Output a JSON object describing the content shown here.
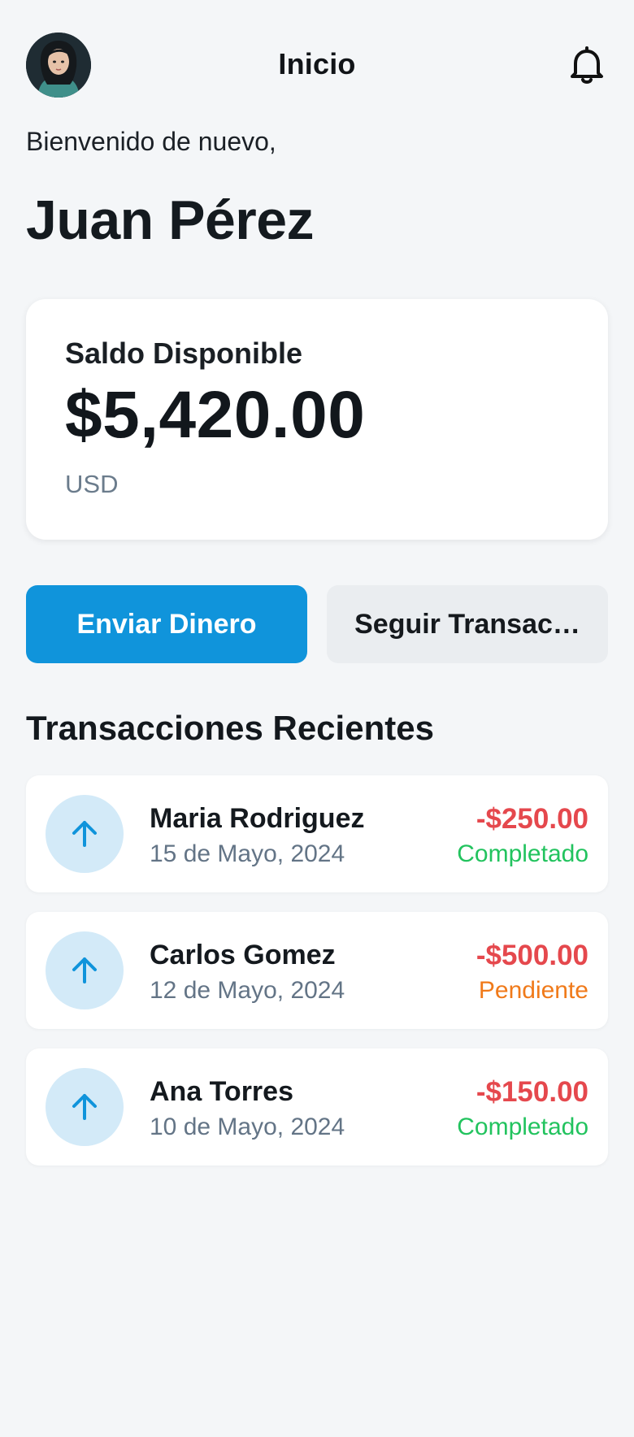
{
  "header": {
    "title": "Inicio",
    "avatar_icon": "user-avatar",
    "notification_icon": "bell-icon"
  },
  "greeting": {
    "welcome": "Bienvenido de nuevo,",
    "name": "Juan Pérez"
  },
  "balance": {
    "label": "Saldo Disponible",
    "amount": "$5,420.00",
    "currency": "USD"
  },
  "actions": {
    "send_label": "Enviar Dinero",
    "track_label": "Seguir Transac…"
  },
  "recent": {
    "title": "Transacciones Recientes",
    "items": [
      {
        "name": "Maria Rodriguez",
        "date": "15 de Mayo, 2024",
        "amount": "-$250.00",
        "status": "Completado",
        "icon": "arrow-up-icon"
      },
      {
        "name": "Carlos Gomez",
        "date": "12 de Mayo, 2024",
        "amount": "-$500.00",
        "status": "Pendiente",
        "icon": "arrow-up-icon"
      },
      {
        "name": "Ana Torres",
        "date": "10 de Mayo, 2024",
        "amount": "-$150.00",
        "status": "Completado",
        "icon": "arrow-up-icon"
      }
    ]
  },
  "colors": {
    "accent": "#1094db",
    "debit": "#e5484d",
    "completed": "#22c35e",
    "pending": "#f07a1a"
  }
}
